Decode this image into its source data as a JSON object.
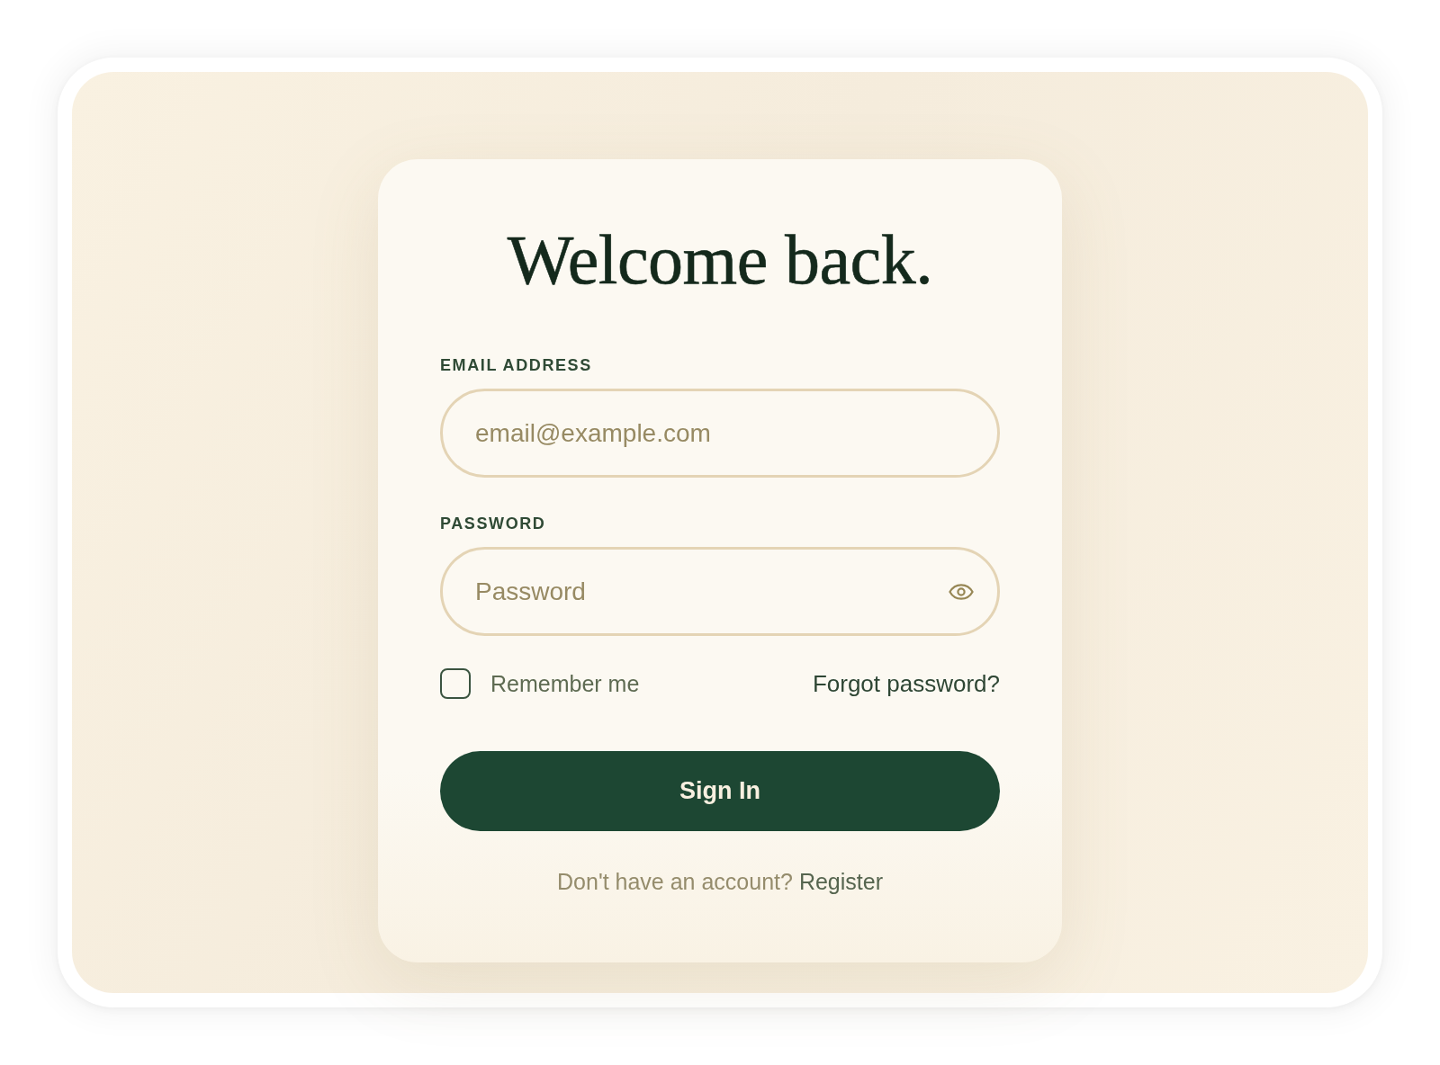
{
  "login_card": {
    "title": "Welcome back.",
    "fields": [
      {
        "kind": "email",
        "label": "EMAIL ADDRESS",
        "placeholder": "email@example.com"
      },
      {
        "kind": "password",
        "label": "PASSWORD",
        "placeholder": "Password"
      }
    ],
    "remember_me": {
      "label": "Remember me",
      "checked": false
    },
    "forgot_password_link": "Forgot password?",
    "submit_button": "Sign In",
    "register_prompt": {
      "text": "Don't have an account?",
      "link": "Register"
    }
  }
}
